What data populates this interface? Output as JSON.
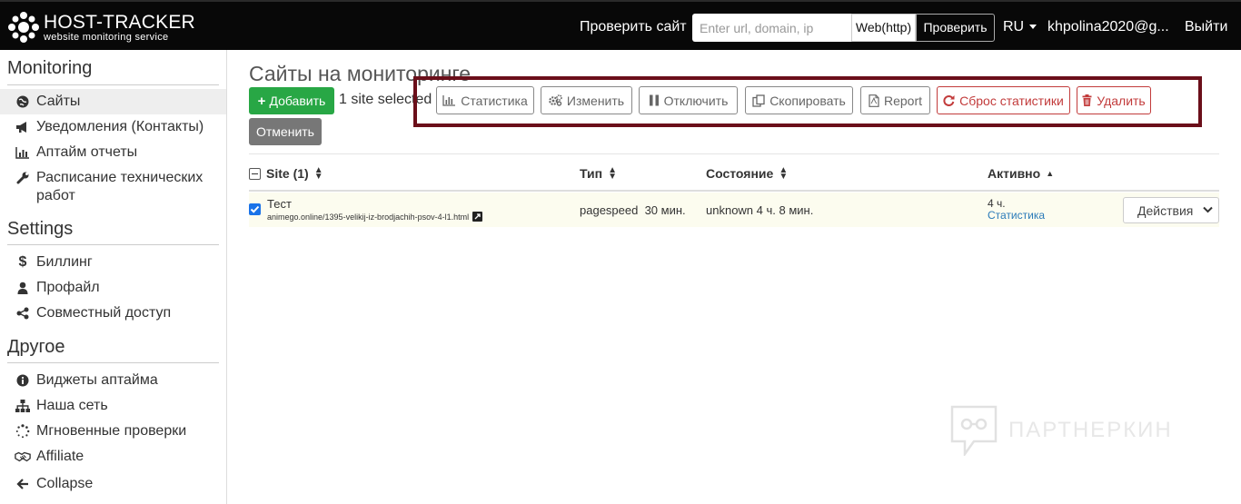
{
  "navbar": {
    "logo_title": "HOST-TRACKER",
    "logo_subtitle": "website monitoring service",
    "check_label": "Проверить сайт",
    "url_placeholder": "Enter url, domain, ip",
    "check_type": "Web(http)",
    "check_button": "Проверить",
    "language": "RU",
    "user": "khpolina2020@g...",
    "logout": "Выйти"
  },
  "sidebar": {
    "sections": [
      {
        "title": "Monitoring",
        "items": [
          {
            "label": "Сайты",
            "icon": "globe-icon",
            "active": true
          },
          {
            "label": "Уведомления (Контакты)",
            "icon": "bullhorn-icon"
          },
          {
            "label": "Аптайм отчеты",
            "icon": "bar-chart-icon"
          },
          {
            "label": "Расписание технических работ",
            "icon": "wrench-icon"
          }
        ]
      },
      {
        "title": "Settings",
        "items": [
          {
            "label": "Биллинг",
            "icon": "dollar-icon"
          },
          {
            "label": "Профайл",
            "icon": "user-icon"
          },
          {
            "label": "Совместный доступ",
            "icon": "share-icon"
          }
        ]
      },
      {
        "title": "Другое",
        "items": [
          {
            "label": "Виджеты аптайма",
            "icon": "info-icon"
          },
          {
            "label": "Наша сеть",
            "icon": "sitemap-icon"
          },
          {
            "label": "Мгновенные проверки",
            "icon": "spinner-icon"
          },
          {
            "label": "Affiliate",
            "icon": "handshake-icon"
          },
          {
            "label": "Collapse",
            "icon": "arrow-left-icon"
          }
        ]
      }
    ]
  },
  "main": {
    "title": "Сайты на мониторинге",
    "add_button": "Добавить",
    "selected_text": "1 site selected",
    "cancel_button": "Отменить",
    "toolbar": [
      {
        "label": "Статистика",
        "icon": "bar-chart-icon"
      },
      {
        "label": "Изменить",
        "icon": "cogs-icon"
      },
      {
        "label": "Отключить",
        "icon": "pause-icon"
      },
      {
        "label": "Скопировать",
        "icon": "copy-icon"
      },
      {
        "label": "Report",
        "icon": "pdf-file-icon"
      },
      {
        "label": "Сброс статистики",
        "icon": "refresh-icon",
        "danger": true
      },
      {
        "label": "Удалить",
        "icon": "trash-icon",
        "danger": true
      }
    ],
    "table": {
      "headers": [
        "Site (1)",
        "Тип",
        "Состояние",
        "Активно"
      ],
      "rows": [
        {
          "checked": true,
          "name": "Тест",
          "url": "animego.online/1395-velikij-iz-brodjachih-psov-4-l1.html",
          "type": "pagespeed",
          "interval": "30 мин.",
          "status": "unknown 4 ч. 8 мин.",
          "active": "4 ч.",
          "active_link": "Статистика",
          "actions": "Действия"
        }
      ]
    }
  },
  "watermark": "ПАРТНЕРКИН",
  "colors": {
    "navbar_bg": "#080808",
    "add_green": "#28a745",
    "cancel_gray": "#777777",
    "danger_red": "#c23b3b",
    "highlight_border": "#6b0f1a",
    "checkbox_blue": "#1a73e8",
    "link_blue": "#2a7ab9"
  }
}
